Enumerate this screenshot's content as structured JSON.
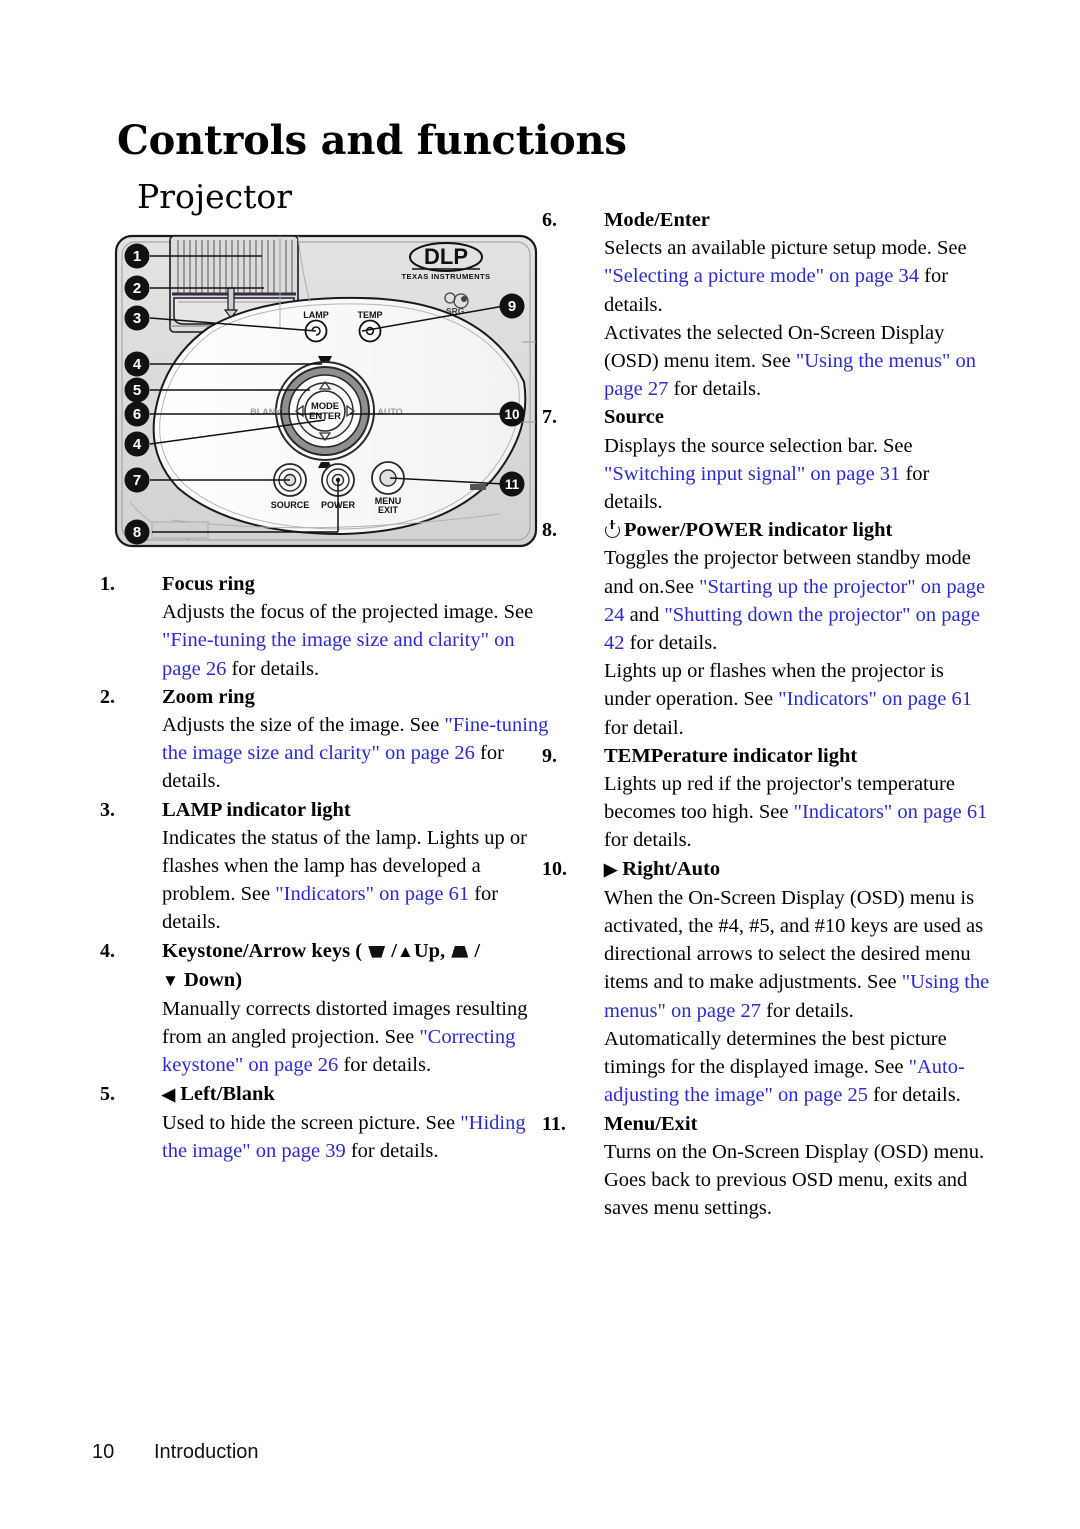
{
  "document": {
    "title": "Controls and functions",
    "subtitle": "Projector"
  },
  "footer": {
    "page_number": "10",
    "section": "Introduction"
  },
  "diagram": {
    "name": "projector-top-view",
    "brand_logo": "DLP",
    "brand_sub": "TEXAS INSTRUMENTS",
    "labels": {
      "lamp": "LAMP",
      "temp": "TEMP",
      "mode": "MODE",
      "enter": "ENTER",
      "blank": "BLANK",
      "auto": "AUTO",
      "source": "SOURCE",
      "power": "POWER",
      "menu": "MENU",
      "exit": "EXIT"
    },
    "callouts": [
      "1",
      "2",
      "3",
      "4",
      "5",
      "6",
      "4",
      "7",
      "8",
      "9",
      "10",
      "11"
    ]
  },
  "left_column": [
    {
      "number": "1.",
      "term": "Focus ring",
      "lines": [
        [
          {
            "t": "Adjusts the focus of the projected image. See ",
            "link": false
          },
          {
            "t": "\"Fine-tuning the image size and clarity\" on page 26",
            "link": true
          },
          {
            "t": " for details.",
            "link": false
          }
        ]
      ]
    },
    {
      "number": "2.",
      "term": "Zoom ring",
      "lines": [
        [
          {
            "t": "Adjusts the size of the image. See ",
            "link": false
          },
          {
            "t": "\"Fine-tuning the image size and clarity\" on page 26",
            "link": true
          },
          {
            "t": " for details.",
            "link": false
          }
        ]
      ]
    },
    {
      "number": "3.",
      "term": "LAMP indicator light",
      "lines": [
        [
          {
            "t": "Indicates the status of the lamp. Lights up or flashes when the lamp has developed a problem. See ",
            "link": false
          },
          {
            "t": "\"Indicators\" on page 61",
            "link": true
          },
          {
            "t": " for details.",
            "link": false
          }
        ]
      ]
    },
    {
      "number": "4.",
      "term_prefix": "Keystone/Arrow keys ( ",
      "term_icons": [
        "keystone-wide-top-icon",
        "/",
        "triangle-up-icon",
        "Up, ",
        "keystone-narrow-top-icon",
        "/",
        "triangle-down-icon",
        "Down)"
      ],
      "term": "Keystone/Arrow keys ( ▼ /▲Up, ▲ / ▼ Down)",
      "lines": [
        [
          {
            "t": "Manually corrects distorted images resulting from an angled projection. See ",
            "link": false
          },
          {
            "t": "\"Correcting keystone\" on page 26",
            "link": true
          },
          {
            "t": " for details.",
            "link": false
          }
        ]
      ]
    },
    {
      "number": "5.",
      "term": "Left/Blank",
      "term_icon": "triangle-left-icon",
      "lines": [
        [
          {
            "t": "Used to hide the screen picture. See ",
            "link": false
          },
          {
            "t": "\"Hiding the image\" on page 39",
            "link": true
          },
          {
            "t": " for details.",
            "link": false
          }
        ]
      ]
    }
  ],
  "right_column": [
    {
      "number": "6.",
      "term": "Mode/Enter",
      "lines": [
        [
          {
            "t": "Selects an available picture setup mode. See ",
            "link": false
          },
          {
            "t": "\"Selecting a picture mode\" on page 34",
            "link": true
          },
          {
            "t": " for details.",
            "link": false
          }
        ],
        [
          {
            "t": "Activates the selected On-Screen Display (OSD) menu item. See ",
            "link": false
          },
          {
            "t": "\"Using the menus\" on page 27",
            "link": true
          },
          {
            "t": " for details.",
            "link": false
          }
        ]
      ]
    },
    {
      "number": "7.",
      "term": "Source",
      "lines": [
        [
          {
            "t": "Displays the source selection bar. See ",
            "link": false
          },
          {
            "t": "\"Switching input signal\" on page 31",
            "link": true
          },
          {
            "t": " for details.",
            "link": false
          }
        ]
      ]
    },
    {
      "number": "8.",
      "term": "Power/POWER indicator light",
      "term_icon": "power-icon",
      "lines": [
        [
          {
            "t": "Toggles the projector between standby mode and on.See ",
            "link": false
          },
          {
            "t": "\"Starting up the projector\" on page 24",
            "link": true
          },
          {
            "t": " and ",
            "link": false
          },
          {
            "t": "\"Shutting down the projector\" on page 42",
            "link": true
          },
          {
            "t": " for details.",
            "link": false
          }
        ],
        [
          {
            "t": "Lights up or flashes when the projector is under operation. See ",
            "link": false
          },
          {
            "t": "\"Indicators\" on page 61",
            "link": true
          },
          {
            "t": " for detail.",
            "link": false
          }
        ]
      ]
    },
    {
      "number": "9.",
      "term": "TEMPerature indicator light",
      "lines": [
        [
          {
            "t": "Lights up red if the projector's temperature becomes too high. See ",
            "link": false
          },
          {
            "t": "\"Indicators\" on page 61",
            "link": true
          },
          {
            "t": " for details.",
            "link": false
          }
        ]
      ]
    },
    {
      "number": "10.",
      "term": "Right/Auto",
      "term_icon": "triangle-right-icon",
      "lines": [
        [
          {
            "t": "When the On-Screen Display (OSD) menu is activated, the #4, #5, and #10 keys are used as directional arrows to select the desired menu items and to make adjustments. See ",
            "link": false
          },
          {
            "t": "\"Using the menus\" on page 27",
            "link": true
          },
          {
            "t": " for details.",
            "link": false
          }
        ],
        [
          {
            "t": "Automatically determines the best picture timings for the displayed image. See ",
            "link": false
          },
          {
            "t": "\"Auto-adjusting the image\" on page 25",
            "link": true
          },
          {
            "t": " for details.",
            "link": false
          }
        ]
      ]
    },
    {
      "number": "11.",
      "term": "Menu/Exit",
      "lines": [
        [
          {
            "t": "Turns on the On-Screen Display (OSD) menu. Goes back to previous OSD menu, exits and saves menu settings.",
            "link": false
          }
        ]
      ]
    }
  ],
  "colors": {
    "link": "#2a2ad0",
    "text": "#000000",
    "callout_bg": "#111111",
    "callout_fg": "#ffffff"
  }
}
